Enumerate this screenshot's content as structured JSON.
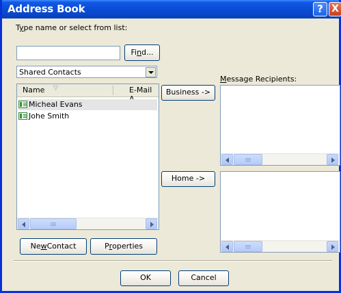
{
  "window": {
    "title": "Address Book",
    "help_symbol": "?",
    "close_symbol": "X"
  },
  "search": {
    "label_underlined": "y",
    "label_prefix": "T",
    "label_suffix": "pe name or select from list:",
    "value": "",
    "find_prefix": "Fi",
    "find_underlined": "n",
    "find_suffix": "d..."
  },
  "source": {
    "selected": "Shared Contacts"
  },
  "contacts": {
    "columns": [
      "Name",
      "E-Mail A"
    ],
    "rows": [
      {
        "name": "Micheal Evans"
      },
      {
        "name": "Johe Smith"
      }
    ]
  },
  "scroll_glyph": "III",
  "recipients": {
    "label_underlined": "M",
    "label_suffix": "essage Recipients:",
    "business_button": "Business ->",
    "home_button": "Home ->"
  },
  "actions": {
    "new_contact_prefix": "Ne",
    "new_contact_underlined": "w",
    "new_contact_suffix": " Contact",
    "properties_prefix": "P",
    "properties_underlined": "r",
    "properties_suffix": "operties",
    "ok": "OK",
    "cancel": "Cancel"
  },
  "colors": {
    "titlebar": "#0a4fd9",
    "dialog_bg": "#ece9d8",
    "close_button": "#c8401c"
  }
}
